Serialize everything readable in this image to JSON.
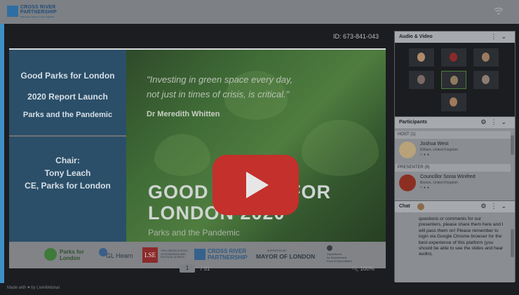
{
  "topbar": {
    "logo_line1": "CROSS RIVER",
    "logo_line2": "PARTNERSHIP",
    "logo_tagline": "Delivering London's Future Together",
    "connection_icon": "wifi-icon"
  },
  "presentation": {
    "meeting_id": "ID: 673-841-043",
    "slide": {
      "left_lines": [
        "Good Parks for London",
        "2020 Report Launch",
        "Parks and the Pandemic"
      ],
      "chair_lines": [
        "Chair:",
        "Tony Leach",
        "CE, Parks for London"
      ],
      "quote_line1": "\"Investing in green space every day,",
      "quote_line2": "not just in times of crisis, is critical.\"",
      "quote_author": "Dr Meredith Whitten",
      "big_title_line1": "GOOD PARKS FOR",
      "big_title_line2": "LONDON 2020",
      "big_subtitle": "Parks and the Pandemic",
      "logos": {
        "parks_for_london": "Parks for\nLondon",
        "gl_hearn": "GL Hearn",
        "lse": "LSE",
        "lse_caption": "THE LONDON SCHOOL\nOF ECONOMICS AND\nPOLITICAL SCIENCE",
        "crp_line1": "CROSS RIVER",
        "crp_line2": "PARTNERSHIP",
        "supported_by": "SUPPORTED BY",
        "mayor": "MAYOR OF LONDON",
        "defra": "Department\nfor Environment\nFood & Rural Affairs"
      }
    },
    "page_current": "1",
    "page_total": "/ 51",
    "zoom": "100%"
  },
  "audio_video": {
    "title": "Audio & Video",
    "tile_count": 8
  },
  "participants": {
    "title": "Participants",
    "host_label": "HOST (1)",
    "host": {
      "name": "Joshua West",
      "location": "Eltham, United Kingdom"
    },
    "presenter_label": "PRESENTER (6)",
    "presenter": {
      "name": "Councillor Sonia Winifred",
      "location": "Brixton, United Kingdom"
    }
  },
  "chat": {
    "title": "Chat",
    "message": "questions or comments for our presenters, please share them here and I will pass them on! Please remember to login via Google Chrome browser for the best experience of this platform (you should be able to see the slides and hear audio)."
  },
  "footer": {
    "text": "Made with ♥ by LiveWebinar"
  },
  "video_overlay": {
    "play_icon": "youtube-play-icon"
  }
}
